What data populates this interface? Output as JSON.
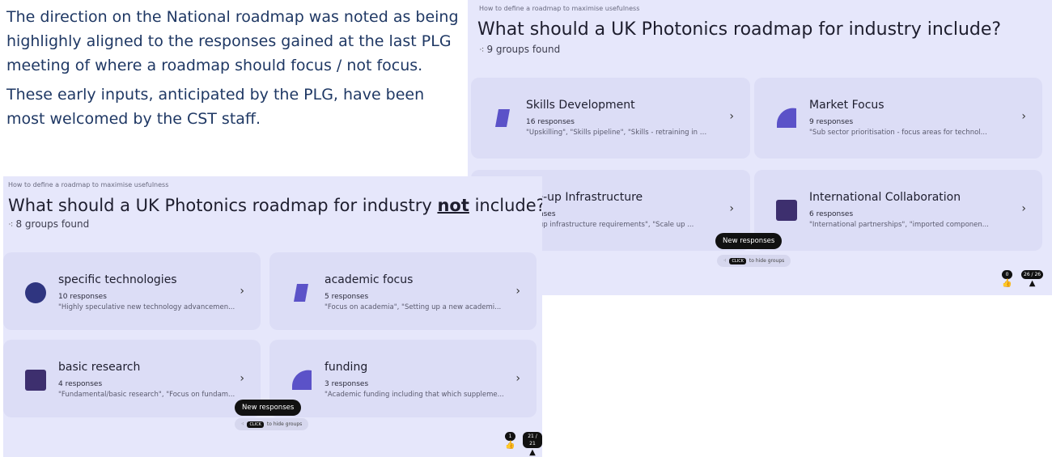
{
  "document": {
    "para1": "The direction on the National roadmap was noted as being highlighly aligned to the responses gained at the last PLG meeting of where a roadmap should focus / not focus.",
    "para2": "These early inputs, anticipated by the PLG, have been most welcomed by the CST staff."
  },
  "slide_back": {
    "kicker": "How to define a roadmap to maximise usefulness",
    "title": "What should a UK Photonics roadmap for industry include?",
    "groups_found": "9 groups found",
    "cards": [
      {
        "name": "Skills Development",
        "count": "16 responses",
        "quote": "\"Upskilling\", \"Skills pipeline\", \"Skills - retraining in pa...",
        "shape": "parallelogram",
        "color": "#5b52c8"
      },
      {
        "name": "Market Focus",
        "count": "9 responses",
        "quote": "\"Sub sector prioritisation - focus areas for technol...",
        "shape": "quarter-circle",
        "color": "#5b52c8"
      },
      {
        "name": "ale-up Infrastructure",
        "count": "sponses",
        "quote": "ale-up infrastructure requirements\", \"Scale up ...",
        "shape": "none",
        "color": "#5b52c8"
      },
      {
        "name": "International Collaboration",
        "count": "6 responses",
        "quote": "\"International partnerships\", \"imported componen...",
        "shape": "square",
        "color": "#3d2f6e"
      }
    ],
    "new_responses": "New responses",
    "hide_prefix": "CLICK",
    "hide_suffix": "to hide groups",
    "likes": "0",
    "participants": "26 / 26"
  },
  "slide_front": {
    "kicker": "How to define a roadmap to maximise usefulness",
    "title_pre": "What should a UK Photonics roadmap for industry ",
    "title_em": "not",
    "title_post": " include?",
    "groups_found": "8 groups found",
    "cards": [
      {
        "name": "specific technologies",
        "count": "10 responses",
        "quote": "\"Highly speculative new technology advancemen...",
        "shape": "circle",
        "color": "#2f3580"
      },
      {
        "name": "academic focus",
        "count": "5 responses",
        "quote": "\"Focus on academia\", \"Setting up a new academi...",
        "shape": "parallelogram",
        "color": "#5b52c8"
      },
      {
        "name": "basic research",
        "count": "4 responses",
        "quote": "\"Fundamental/basic research\", \"Focus on fundam...",
        "shape": "square",
        "color": "#3d2f6e"
      },
      {
        "name": "funding",
        "count": "3 responses",
        "quote": "\"Academic funding including that which suppleme...",
        "shape": "quarter-circle",
        "color": "#5b52c8"
      }
    ],
    "new_responses": "New responses",
    "hide_prefix": "CLICK",
    "hide_suffix": "to hide groups",
    "likes": "1",
    "participants": "21 / 21"
  },
  "icons": {
    "sparkle": "sparkle-icon",
    "chevron": "chevron-right-icon",
    "thumb": "thumbs-up-icon",
    "person": "person-icon"
  }
}
